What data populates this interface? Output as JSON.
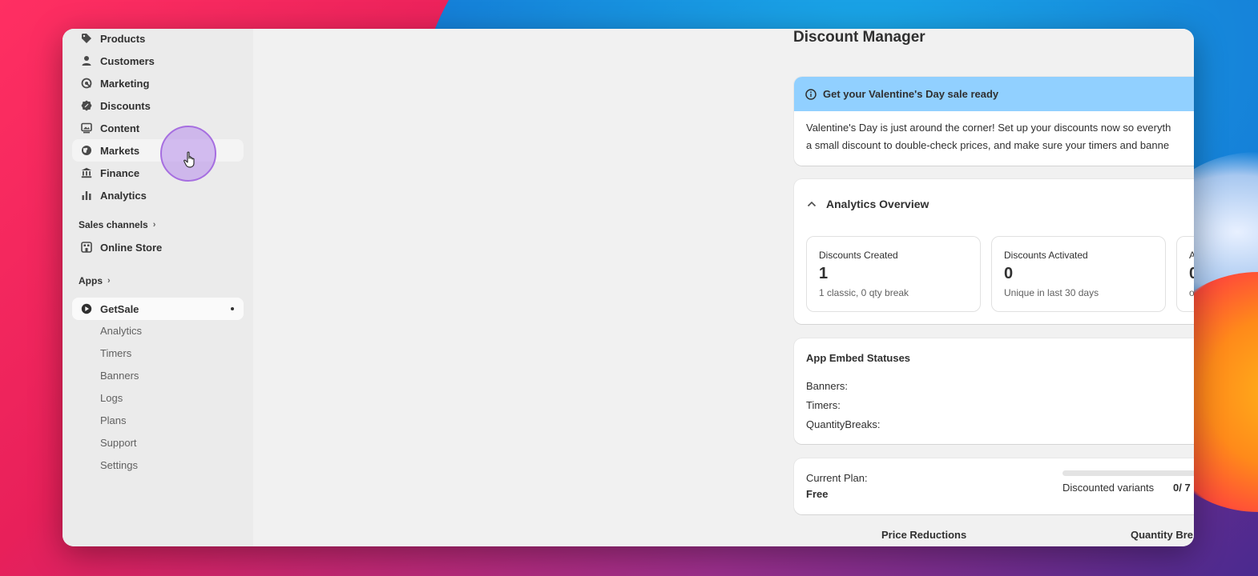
{
  "sidebar": {
    "items": [
      {
        "label": "Products",
        "icon": "tag-icon"
      },
      {
        "label": "Customers",
        "icon": "person-icon"
      },
      {
        "label": "Marketing",
        "icon": "target-icon"
      },
      {
        "label": "Discounts",
        "icon": "discount-badge-icon"
      },
      {
        "label": "Content",
        "icon": "image-icon"
      },
      {
        "label": "Markets",
        "icon": "globe-icon"
      },
      {
        "label": "Finance",
        "icon": "bank-icon"
      },
      {
        "label": "Analytics",
        "icon": "bar-chart-icon"
      }
    ],
    "sales_channels_label": "Sales channels",
    "online_store_label": "Online Store",
    "apps_label": "Apps",
    "app_name": "GetSale",
    "app_sub_items": [
      "Analytics",
      "Timers",
      "Banners",
      "Logs",
      "Plans",
      "Support",
      "Settings"
    ]
  },
  "main": {
    "page_title": "Discount Manager",
    "banner": {
      "title": "Get your Valentine's Day sale ready",
      "line1": "Valentine's Day is just around the corner! Set up your discounts now so everyth",
      "line2": "a small discount to double-check prices, and make sure your timers and banne"
    },
    "analytics": {
      "title": "Analytics Overview",
      "stats": [
        {
          "label": "Discounts Created",
          "value": "1",
          "sub": "1 classic, 0 qty break"
        },
        {
          "label": "Discounts Activated",
          "value": "0",
          "sub": "Unique in last 30 days"
        },
        {
          "label": "A",
          "value": "0",
          "sub": "o"
        }
      ]
    },
    "embeds": {
      "title": "App Embed Statuses",
      "rows": [
        "Banners:",
        "Timers:",
        "QuantityBreaks:"
      ]
    },
    "plan": {
      "label": "Current Plan:",
      "value": "Free",
      "variants_label": "Discounted variants",
      "variants_value": "0/ 7",
      "variants_progress": 0
    },
    "tabs": [
      "Price Reductions",
      "Quantity Bre"
    ]
  },
  "colors": {
    "banner_bg": "#91d0ff",
    "cursor_highlight": "#b78ceb"
  }
}
